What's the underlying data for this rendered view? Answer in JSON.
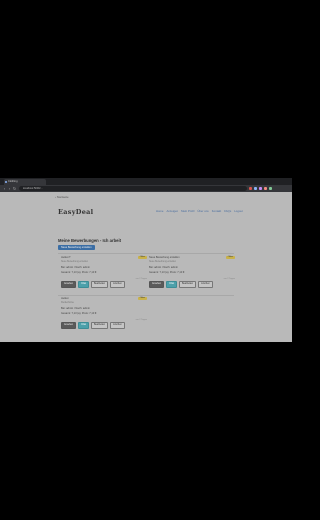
{
  "browser": {
    "tab_title": "Clothing",
    "url": "localhost:5000/...",
    "nav_back": "‹",
    "nav_forward": "›",
    "nav_reload": "↻",
    "ext_colors": [
      "#d9534f",
      "#8ab4f8",
      "#c58af9",
      "#f28b82",
      "#81c995"
    ]
  },
  "page": {
    "back_link": "‹ Startseite",
    "logo": "EasyDeal",
    "nav": [
      "Home",
      "Anzeigen",
      "Mein Profil",
      "Über uns",
      "Kontakt",
      "FAQs",
      "Logout"
    ],
    "heading": "Meine Bewerbungen - Ich arbeit",
    "new_button": "Neue Bewerbung erstellen",
    "cards": [
      {
        "title": "Jacket T",
        "badge": "Offen",
        "sub": "Neue Bewerbung erstellen",
        "line1": "Bei: admin / Nach: admin",
        "line2": "Gesamt: 7,13 (a), Preis: 7,13 €",
        "date": "vor 2 Tagen",
        "actions": [
          "Ansehen",
          "Chat",
          "Bearbeiten",
          "Löschen"
        ]
      },
      {
        "title": "Neue Bewerbung erstellen",
        "badge": "Offen",
        "sub": "Neue Bewerbung erstellen",
        "line1": "Bei: admin / Nach: admin",
        "line2": "Gesamt: 7,13 (a), Preis: 7,13 €",
        "date": "vor 2 Tagen",
        "actions": [
          "Ansehen",
          "Chat",
          "Bearbeiten",
          "Löschen"
        ]
      },
      {
        "title": "Jacket",
        "badge": "Offen",
        "sub": "Kleiderbörse",
        "line1": "Bei: admin / Nach: admin",
        "line2": "Gesamt: 7,13 (a), Preis: 7,13 €",
        "date": "vor 2 Tagen",
        "actions": [
          "Ansehen",
          "Chat",
          "Bearbeiten",
          "Löschen"
        ]
      }
    ]
  }
}
